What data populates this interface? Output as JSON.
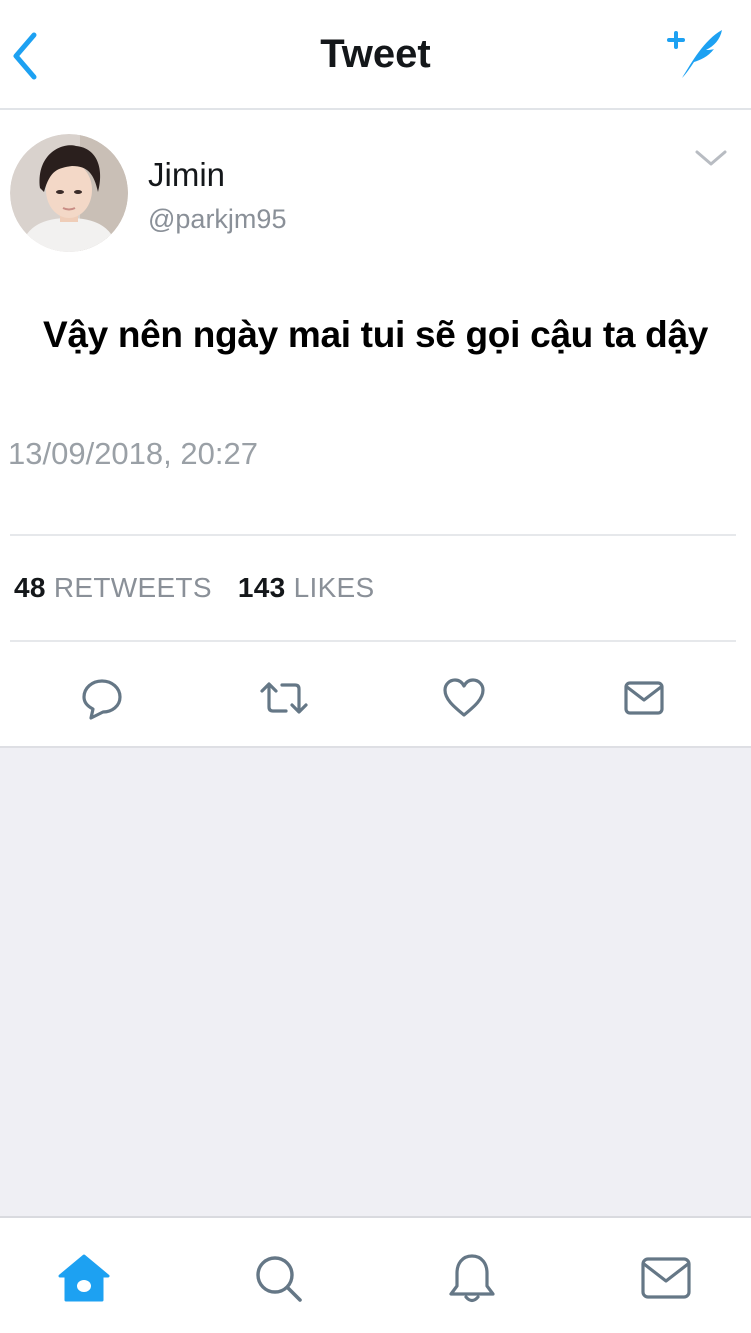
{
  "header": {
    "title": "Tweet",
    "back_icon": "chevron-left-icon",
    "compose_icon": "compose-feather-icon",
    "accent_color": "#1da1f2"
  },
  "tweet": {
    "author": {
      "display_name": "Jimin",
      "handle": "@parkjm95"
    },
    "text": "Vậy nên ngày mai tui sẽ gọi cậu ta dậy",
    "timestamp": "13/09/2018, 20:27",
    "stats": {
      "retweets_count": "48",
      "retweets_label": "RETWEETS",
      "likes_count": "143",
      "likes_label": "LIKES"
    },
    "actions": [
      "reply-icon",
      "retweet-icon",
      "like-icon",
      "share-dm-icon"
    ]
  },
  "tabbar": {
    "tabs": [
      "home-icon",
      "search-icon",
      "notifications-icon",
      "messages-icon"
    ],
    "active": "home-icon"
  },
  "colors": {
    "muted_text": "#8a9098",
    "background_gray": "#efeff4",
    "icon_gray": "#657786"
  }
}
